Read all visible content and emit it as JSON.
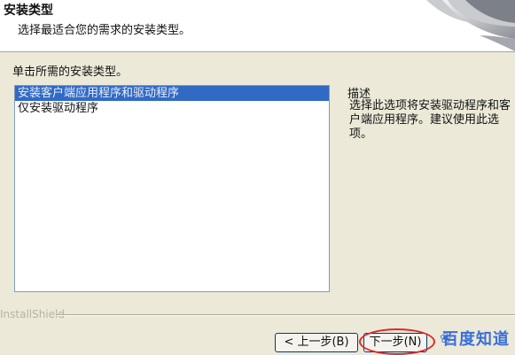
{
  "header": {
    "title": "安装类型",
    "subtitle": "选择最适合您的需求的安装类型。"
  },
  "prompt": "单击所需的安装类型。",
  "setup_types": [
    {
      "label": "安装客户端应用程序和驱动程序",
      "selected": true
    },
    {
      "label": "仅安装驱动程序",
      "selected": false
    }
  ],
  "description": {
    "title": "描述",
    "text": "选择此选项将安装驱动程序和客户端应用程序。建议使用此选项。"
  },
  "brand": "InstallShield",
  "buttons": {
    "back": "< 上一步(B)",
    "next": "下一步(N)"
  },
  "watermark": "百度知道",
  "colors": {
    "selection": "#316ac5",
    "highlight_circle": "#e0282c",
    "watermark": "#3b6fd6"
  }
}
